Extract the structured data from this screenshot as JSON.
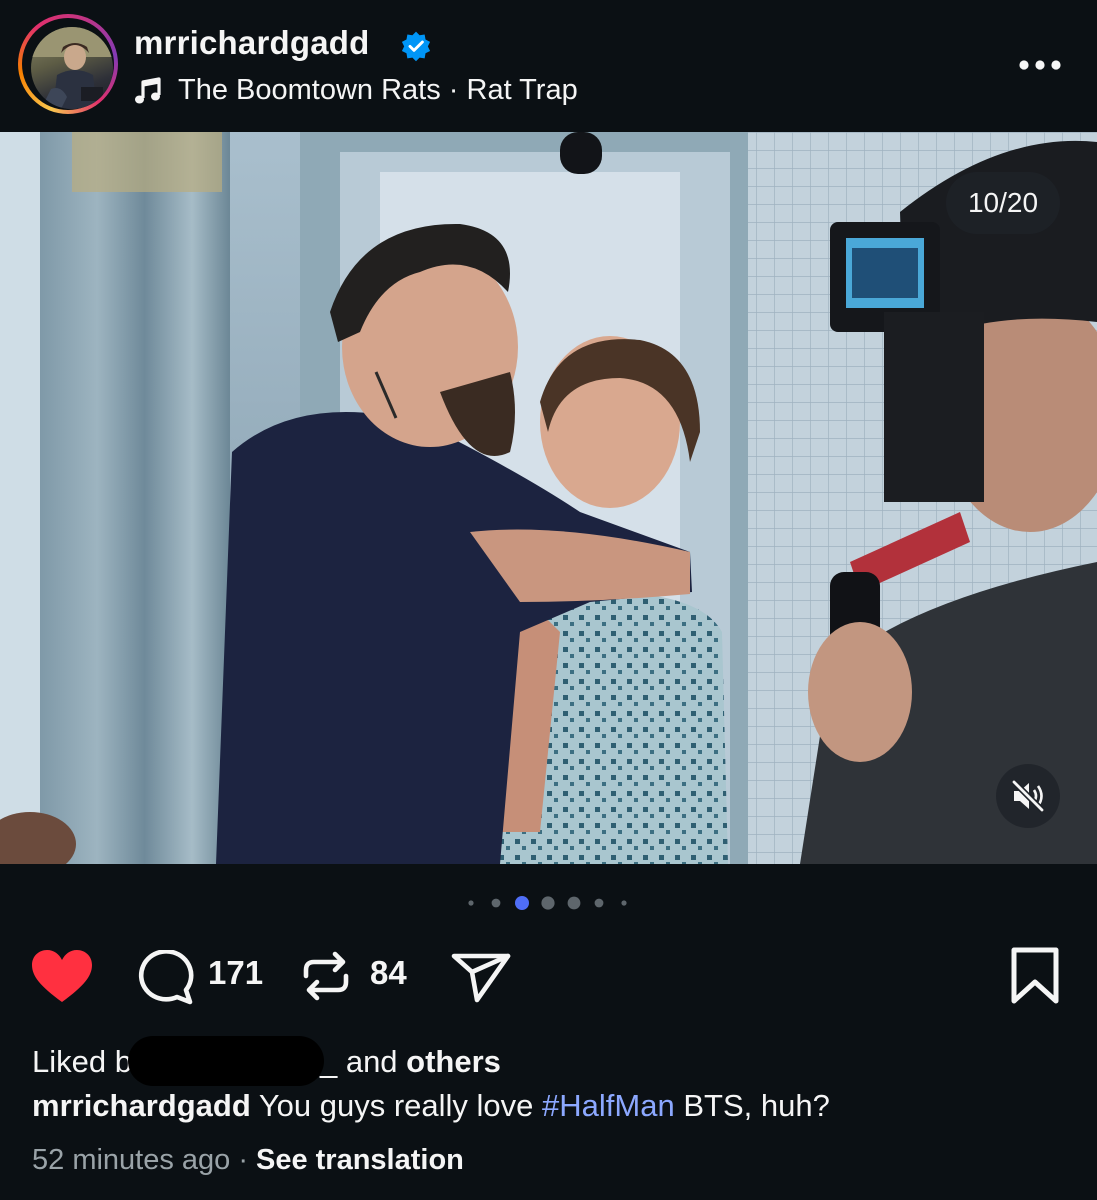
{
  "post": {
    "username": "mrrichardgadd",
    "audio": "The Boomtown Rats · Rat Trap",
    "slide_counter": "10/20",
    "current_slide": 10,
    "total_slides": 20,
    "liked": true,
    "stats": {
      "comments": "171",
      "reposts": "84"
    },
    "likes": {
      "prefix": "Liked b",
      "suffix": "_ and ",
      "others": "others"
    },
    "caption": {
      "author": "mrrichardgadd",
      "text_before": " You guys really love ",
      "hashtag": "#HalfMan",
      "text_after": " BTS, huh?"
    },
    "time_ago": "52 minutes ago",
    "translation_link": "See translation"
  },
  "icons": {
    "verified": "verified-badge-icon",
    "music": "music-note-icon",
    "more": "more-options-icon",
    "mute": "muted-audio-icon",
    "like": "heart-icon",
    "comment": "comment-icon",
    "repost": "repost-icon",
    "share": "share-icon",
    "save": "bookmark-icon"
  },
  "colors": {
    "background": "#0b1014",
    "like": "#ff3040",
    "verified": "#0095f6",
    "hashtag": "#8ca8ff",
    "active_dot": "#4f6ef7"
  }
}
